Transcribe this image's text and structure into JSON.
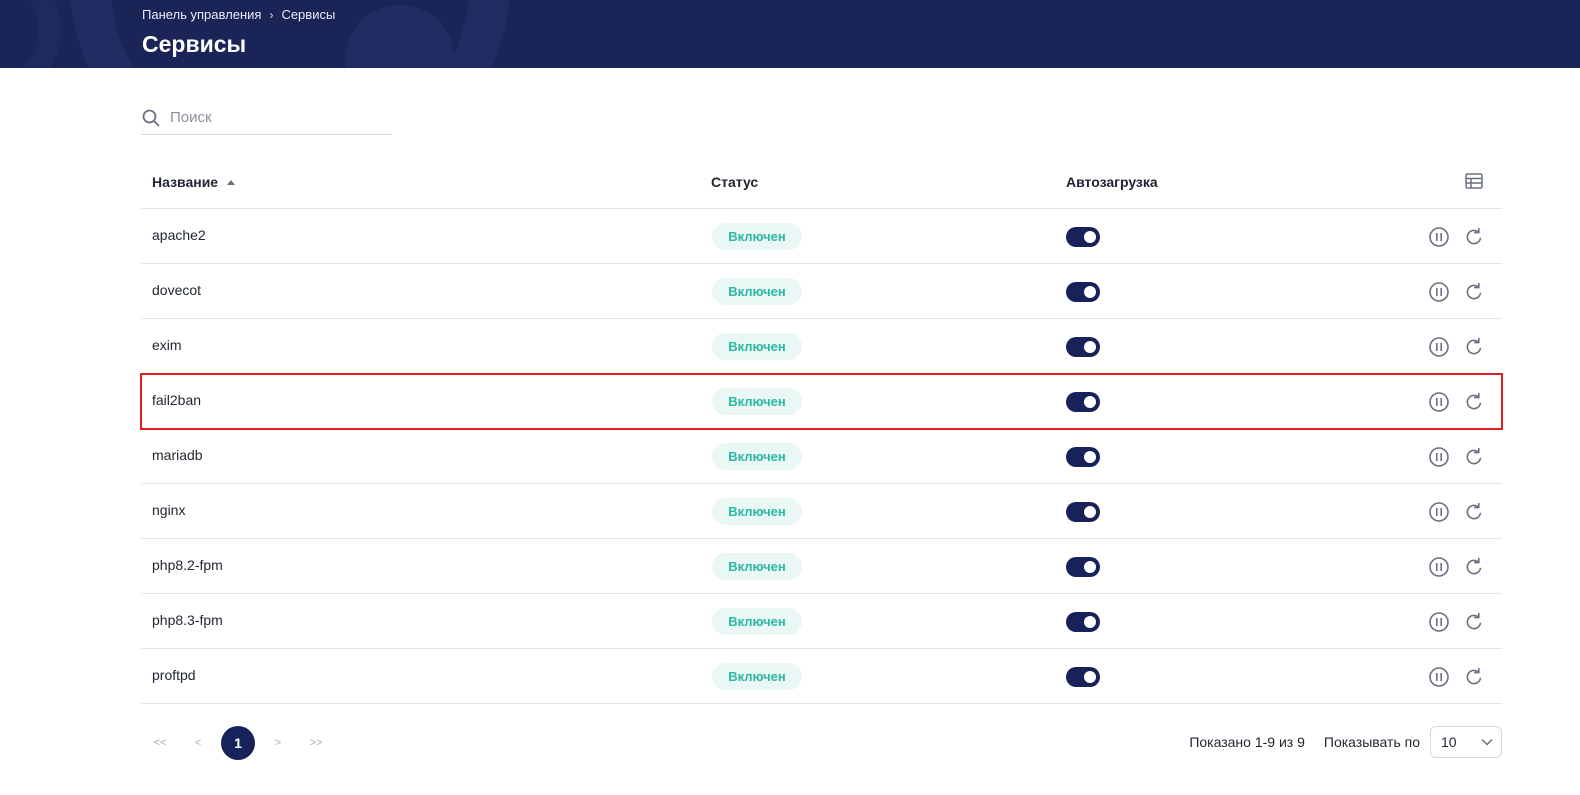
{
  "header": {
    "breadcrumb": [
      "Панель управления",
      "Сервисы"
    ],
    "title": "Сервисы"
  },
  "search": {
    "placeholder": "Поиск"
  },
  "table": {
    "columns": {
      "name": "Название",
      "status": "Статус",
      "autostart": "Автозагрузка"
    },
    "sort": {
      "column": "name",
      "direction": "asc"
    },
    "rows": [
      {
        "name": "apache2",
        "status": "Включен",
        "autostart": true,
        "highlighted": false
      },
      {
        "name": "dovecot",
        "status": "Включен",
        "autostart": true,
        "highlighted": false
      },
      {
        "name": "exim",
        "status": "Включен",
        "autostart": true,
        "highlighted": false
      },
      {
        "name": "fail2ban",
        "status": "Включен",
        "autostart": true,
        "highlighted": true
      },
      {
        "name": "mariadb",
        "status": "Включен",
        "autostart": true,
        "highlighted": false
      },
      {
        "name": "nginx",
        "status": "Включен",
        "autostart": true,
        "highlighted": false
      },
      {
        "name": "php8.2-fpm",
        "status": "Включен",
        "autostart": true,
        "highlighted": false
      },
      {
        "name": "php8.3-fpm",
        "status": "Включен",
        "autostart": true,
        "highlighted": false
      },
      {
        "name": "proftpd",
        "status": "Включен",
        "autostart": true,
        "highlighted": false
      }
    ],
    "row_actions": [
      "pause-icon",
      "restart-icon"
    ]
  },
  "pagination": {
    "first": "<<",
    "prev": "<",
    "current": "1",
    "next": ">",
    "last": ">>",
    "shown": "Показано 1-9 из 9",
    "per_page_label": "Показывать по",
    "per_page": "10"
  },
  "colors": {
    "header_bg": "#1b2456",
    "accent": "#18225a",
    "status_text": "#2bb8a2",
    "status_bg": "#eaf8f5",
    "highlight": "#e02020"
  }
}
